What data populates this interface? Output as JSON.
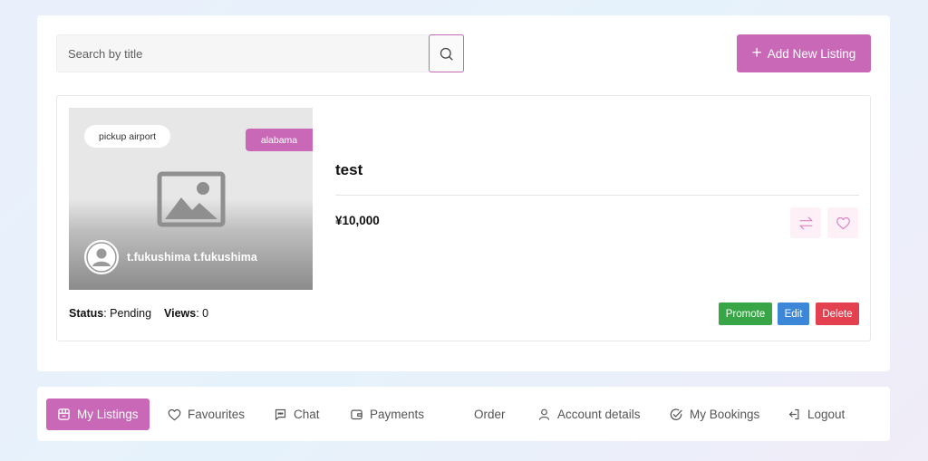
{
  "search": {
    "placeholder": "Search by title"
  },
  "toolbar": {
    "add_label": "Add New Listing"
  },
  "listing": {
    "badge": "pickup airport",
    "location_tag": "alabama",
    "author": "t.fukushima t.fukushima",
    "title": "test",
    "price": "¥10,000",
    "status_label": "Status",
    "status_value": "Pending",
    "views_label": "Views",
    "views_value": "0",
    "actions": {
      "promote": "Promote",
      "edit": "Edit",
      "delete": "Delete"
    }
  },
  "nav": {
    "items": [
      {
        "label": "My Listings",
        "icon": "store-icon",
        "active": true
      },
      {
        "label": "Favourites",
        "icon": "heart-icon"
      },
      {
        "label": "Chat",
        "icon": "chat-icon"
      },
      {
        "label": "Payments",
        "icon": "wallet-icon"
      },
      {
        "label": "Order",
        "icon": ""
      },
      {
        "label": "Account details",
        "icon": "user-icon"
      },
      {
        "label": "My Bookings",
        "icon": "check-circle-icon"
      },
      {
        "label": "Logout",
        "icon": "logout-icon"
      }
    ]
  },
  "colors": {
    "accent": "#c968b7",
    "promote": "#38a646",
    "edit": "#3c87d7",
    "delete": "#e34150"
  }
}
